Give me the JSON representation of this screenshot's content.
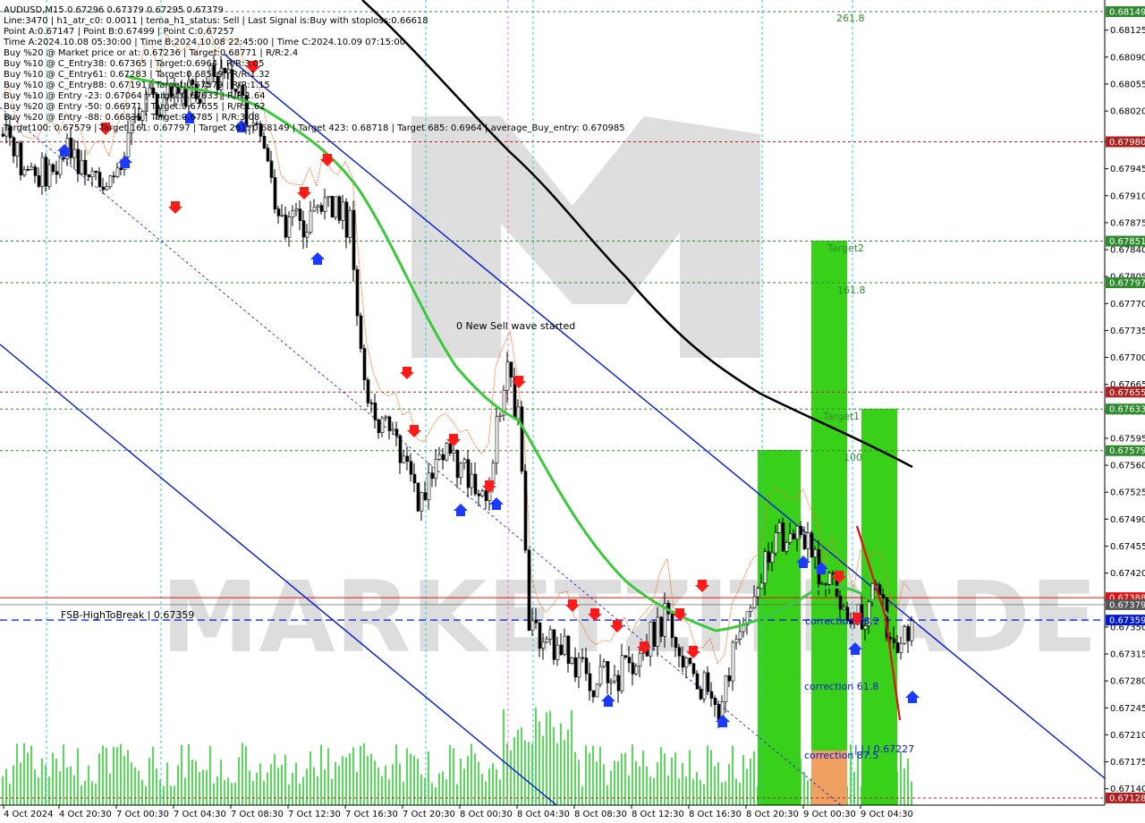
{
  "header": {
    "symbol_line": "AUDUSD,M15  0.67296 0.67379 0.67295 0.67379",
    "lines": [
      "Line:3470  |  h1_atr_c0: 0.0011  |  tema_h1_status: Sell  |  Last Signal is:Buy with stoploss:0.66618",
      "Point A:0.67147  |  Point B:0.67499  |  Point C:0.67257",
      "Time A:2024.10.08 05:30:00  |  Time B:2024.10.08 22:45:00  |  Time C:2024.10.09 07:15:00",
      "Buy %20 @ Market price or at: 0.67236  |  Target:0.68771  |  R/R:2.4",
      "Buy %10 @ C_Entry38: 0.67365  |  Target:0.6964  |  R/R:3.05",
      "Buy %10 @ C_Entry61: 0.67283  |  Target:0.68519  |  R/R:1.32",
      "Buy %10 @ C_Entry88: 0.67191  |  Target:0.67579  |  R/R:1.15",
      "Buy %10 @ Entry -23: 0.67064  |  Target:0.67633  |  R/R:1.64",
      "Buy %20 @ Entry -50: 0.66971  |  Target:0.67655  |  R/R:1.62",
      "Buy %20 @ Entry -88: 0.66835  |  Target:0.6785  |  R/R:3.08",
      "Target100: 0.67579  |  Target 161: 0.67797  |  Target 261: 0.68149  |  Target 423: 0.68718  |  Target 685: 0.6964  |  average_Buy_entry: 0.670985"
    ]
  },
  "watermark": "MARKETZITRADE",
  "annotations": {
    "new_wave": "0 New Sell wave started",
    "fsb": "FSB-HighToBreak  |  0.67359",
    "target2": "Target2",
    "target1": "Target1",
    "fib_261": "261.8",
    "fib_161": "161.8",
    "fib_100": "100",
    "correction_38": "correction 38.2",
    "correction_61": "correction 61.8",
    "correction_87": "correction 87.5",
    "point_c": "| | | 0.67227"
  },
  "colors": {
    "bg": "#ffffff",
    "candle": "#000000",
    "ma_green": "#3cc83c",
    "ma_black": "#000000",
    "channel_blue": "#0018d6",
    "red_line": "#e01010",
    "green_level": "#2e8b2e",
    "dark_red_level": "#b02020",
    "box_green": "#39d01a",
    "box_orange": "#f0a060",
    "volume": "#3cd23c",
    "signal_up": "#1a3aff",
    "signal_down": "#ff1a1a"
  },
  "chart_data": {
    "type": "candlestick",
    "symbol": "AUDUSD",
    "timeframe": "M15",
    "ylim": [
      0.67115,
      0.68165
    ],
    "y_ticks": [
      0.68125,
      0.6809,
      0.68055,
      0.6802,
      0.6798,
      0.67945,
      0.6791,
      0.67875,
      0.6784,
      0.67805,
      0.6777,
      0.67735,
      0.677,
      0.67665,
      0.6763,
      0.67595,
      0.6756,
      0.67525,
      0.6749,
      0.67455,
      0.6742,
      0.67385,
      0.6735,
      0.67315,
      0.6728,
      0.67245,
      0.6721,
      0.67175,
      0.6714
    ],
    "x_ticks": [
      "4 Oct 2024",
      "4 Oct 20:30",
      "7 Oct 00:30",
      "7 Oct 04:30",
      "7 Oct 08:30",
      "7 Oct 12:30",
      "7 Oct 16:30",
      "7 Oct 20:30",
      "8 Oct 00:30",
      "8 Oct 04:30",
      "8 Oct 08:30",
      "8 Oct 12:30",
      "8 Oct 16:30",
      "8 Oct 20:30",
      "9 Oct 00:30",
      "9 Oct 04:30"
    ],
    "price_tags": [
      {
        "value": "0.68149",
        "color": "#2e8b2e"
      },
      {
        "value": "0.67980",
        "color": "#b02020"
      },
      {
        "value": "0.67851",
        "color": "#2e8b2e"
      },
      {
        "value": "0.67797",
        "color": "#2e8b2e"
      },
      {
        "value": "0.67655",
        "color": "#b02020"
      },
      {
        "value": "0.67633",
        "color": "#2e8b2e"
      },
      {
        "value": "0.67579",
        "color": "#2e8b2e"
      },
      {
        "value": "0.67388",
        "color": "#e01010"
      },
      {
        "value": "0.67379",
        "color": "#555555"
      },
      {
        "value": "0.67359",
        "color": "#0018d6"
      },
      {
        "value": "0.67128",
        "color": "#b02020"
      }
    ],
    "current_price": 0.67379,
    "fsb_level": 0.67359
  }
}
